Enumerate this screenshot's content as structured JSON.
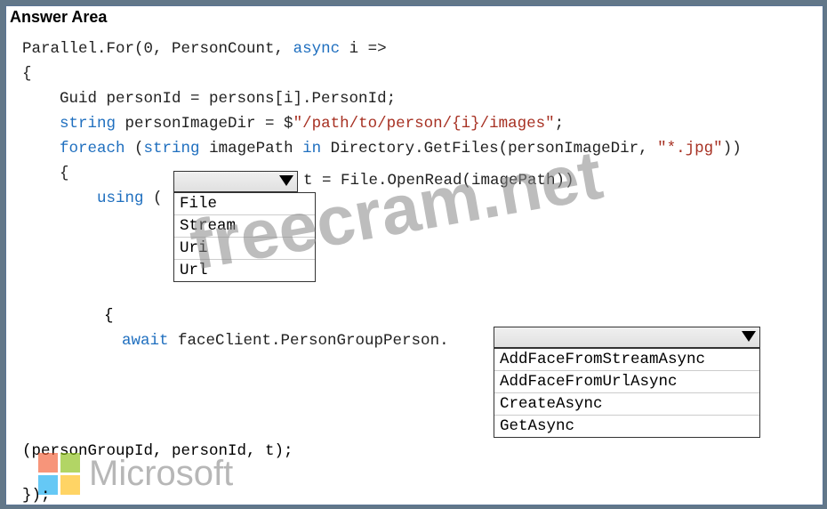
{
  "header": "Answer Area",
  "code": {
    "line1_pre": "Parallel.For(0, PersonCount, ",
    "line1_kw": "async",
    "line1_post": " i =>",
    "line2": "{",
    "line3_pre": "    Guid personId = persons[i].PersonId;",
    "line4_a": "    ",
    "line4_kw": "string",
    "line4_b": " personImageDir = $",
    "line4_str": "\"/path/to/person/{i}/images\"",
    "line4_c": ";",
    "line5_a": "    ",
    "line5_kw": "foreach",
    "line5_b": " (",
    "line5_kw2": "string",
    "line5_c": " imagePath ",
    "line5_kw3": "in",
    "line5_d": " Directory.GetFiles(personImageDir, ",
    "line5_str": "\"*.jpg\"",
    "line5_e": "))",
    "line6": "    {",
    "line7_a": "        ",
    "line7_kw": "using",
    "line7_b": " ( ",
    "after_dd1": " t = File.OpenRead(imagePath))",
    "brace2": "{",
    "await_a": "await",
    "await_b": " faceClient.PersonGroupPerson.",
    "tail": "(personGroupId, personId, t);",
    "closing": "});"
  },
  "dropdown1": {
    "options": [
      "File",
      "Stream",
      "Uri",
      "Url"
    ]
  },
  "dropdown2": {
    "options": [
      "AddFaceFromStreamAsync",
      "AddFaceFromUrlAsync",
      "CreateAsync",
      "GetAsync"
    ]
  },
  "watermark": "freecram.net",
  "mslogo": "Microsoft"
}
